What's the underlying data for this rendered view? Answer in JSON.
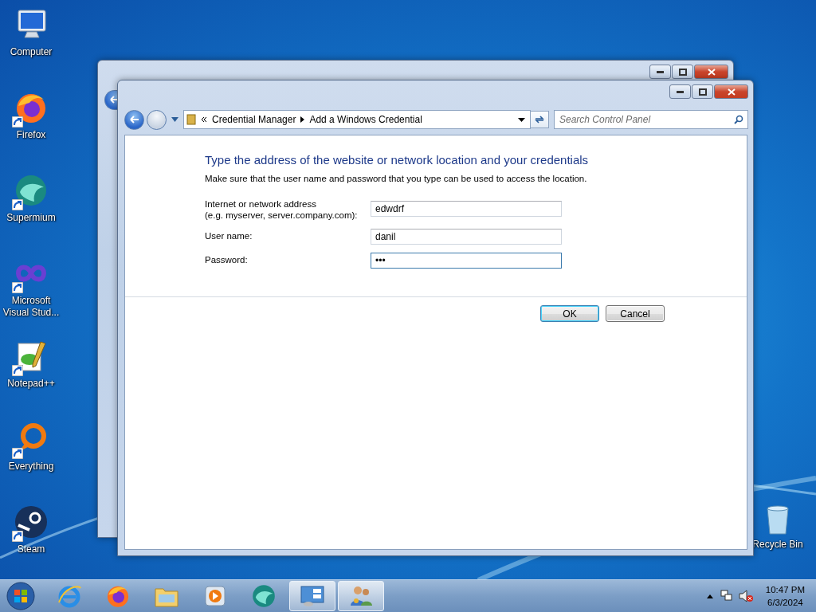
{
  "desktop_icons": [
    {
      "label": "Computer",
      "kind": "computer",
      "shortcut": false
    },
    {
      "label": "Firefox",
      "kind": "firefox",
      "shortcut": true
    },
    {
      "label": "Supermium",
      "kind": "supermium",
      "shortcut": true
    },
    {
      "label": "Microsoft Visual Stud...",
      "kind": "infinity",
      "shortcut": true
    },
    {
      "label": "Notepad++",
      "kind": "notepad",
      "shortcut": true
    },
    {
      "label": "Everything",
      "kind": "everything",
      "shortcut": true
    },
    {
      "label": "Steam",
      "kind": "steam",
      "shortcut": true
    }
  ],
  "recycle_bin": {
    "label": "Recycle Bin"
  },
  "window": {
    "back_enabled": true,
    "forward_enabled": false,
    "breadcrumb": [
      "Credential Manager",
      "Add a Windows Credential"
    ],
    "search": {
      "placeholder": "Search Control Panel"
    },
    "heading": "Type the address of the website or network location and your credentials",
    "description": "Make sure that the user name and password that you type can be used to access the location.",
    "fields": [
      {
        "label": "Internet or network address\n(e.g. myserver, server.company.com):",
        "value": "edwdrf",
        "focused": false
      },
      {
        "label": "User name:",
        "value": "danil",
        "focused": false
      },
      {
        "label": "Password:",
        "value": "•••",
        "focused": true
      }
    ],
    "buttons": [
      {
        "label": "OK",
        "default": true
      },
      {
        "label": "Cancel",
        "default": false
      }
    ]
  },
  "taskbar": {
    "items": [
      {
        "kind": "ie",
        "active": false
      },
      {
        "kind": "firefox",
        "active": false
      },
      {
        "kind": "folder",
        "active": false
      },
      {
        "kind": "media",
        "active": false
      },
      {
        "kind": "supermium",
        "active": false
      },
      {
        "kind": "controlpanel",
        "active": true
      },
      {
        "kind": "credential",
        "active": true
      }
    ],
    "tray": {
      "volume_muted": true
    },
    "clock": {
      "time": "10:47 PM",
      "date": "6/3/2024"
    }
  }
}
